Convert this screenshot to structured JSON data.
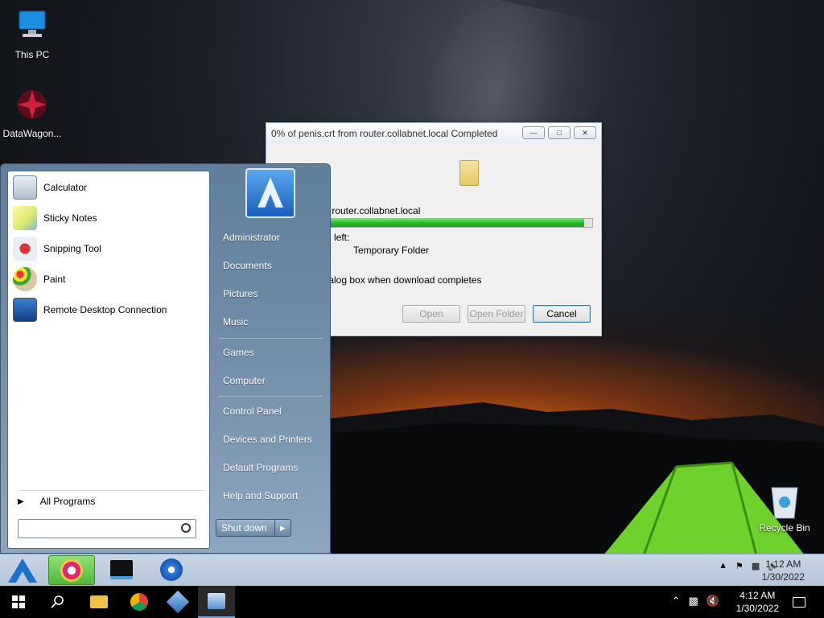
{
  "desktop": {
    "icons": [
      {
        "label": "This PC",
        "icon": "computer-icon"
      },
      {
        "label": "DataWagon...",
        "icon": "datawagon-icon"
      }
    ],
    "recycle_bin": "Recycle Bin"
  },
  "dialog": {
    "title": "0% of penis.crt from router.collabnet.local Completed",
    "source_line": "m router.collabnet.local",
    "time_left_label": "left:",
    "download_to": "Temporary Folder",
    "close_checkbox_text": "dialog box when download completes",
    "progress": 0.97,
    "buttons": {
      "open": "Open",
      "open_folder": "Open Folder",
      "cancel": "Cancel"
    }
  },
  "start_menu": {
    "programs": [
      "Calculator",
      "Sticky Notes",
      "Snipping Tool",
      "Paint",
      "Remote Desktop Connection"
    ],
    "all_programs": "All Programs",
    "right_items": [
      "Administrator",
      "Documents",
      "Pictures",
      "Music",
      "Games",
      "Computer",
      "Control Panel",
      "Devices and Printers",
      "Default Programs",
      "Help and Support"
    ],
    "shutdown": "Shut down"
  },
  "vm_taskbar": {
    "time": "1:12 AM",
    "date": "1/30/2022"
  },
  "host_taskbar": {
    "time": "4:12 AM",
    "date": "1/30/2022"
  },
  "colors": {
    "progress_green": "#27b927",
    "start_menu_blue": "#6f8aa5"
  }
}
